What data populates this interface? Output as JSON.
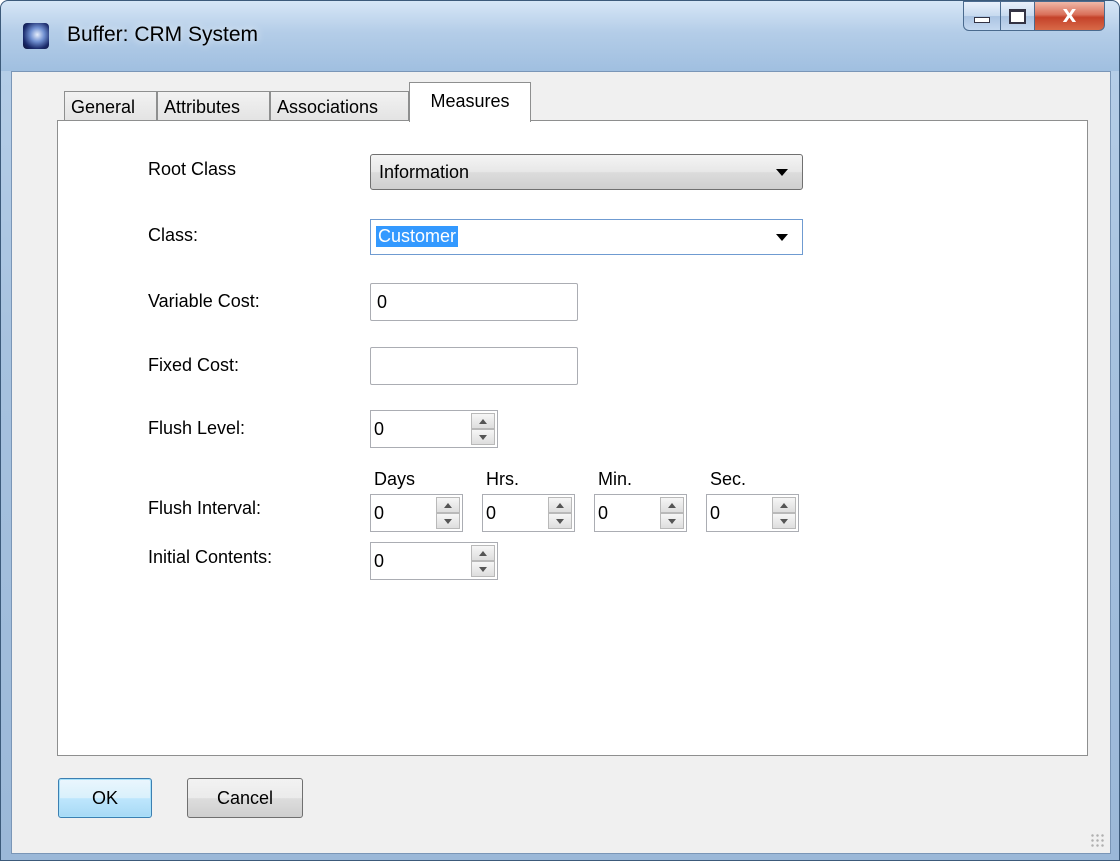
{
  "window": {
    "title": "Buffer: CRM System",
    "minimize_glyph": "",
    "maximize_glyph": "",
    "close_glyph": "X"
  },
  "tabs": [
    {
      "label": "General",
      "active": false
    },
    {
      "label": "Attributes",
      "active": false
    },
    {
      "label": "Associations",
      "active": false
    },
    {
      "label": "Measures",
      "active": true
    }
  ],
  "form": {
    "root_class": {
      "label": "Root Class",
      "value": "Information"
    },
    "class": {
      "label": "Class:",
      "value": "Customer"
    },
    "variable_cost": {
      "label": "Variable Cost:",
      "value": "0"
    },
    "fixed_cost": {
      "label": "Fixed Cost:",
      "value": ""
    },
    "flush_level": {
      "label": "Flush Level:",
      "value": "0"
    },
    "flush_interval": {
      "label": "Flush Interval:",
      "days": {
        "label": "Days",
        "value": "0"
      },
      "hrs": {
        "label": "Hrs.",
        "value": "0"
      },
      "min": {
        "label": "Min.",
        "value": "0"
      },
      "sec": {
        "label": "Sec.",
        "value": "0"
      }
    },
    "initial_contents": {
      "label": "Initial Contents:",
      "value": "0"
    }
  },
  "buttons": {
    "ok": "OK",
    "cancel": "Cancel"
  },
  "icons": {
    "app": "buffer-app-icon",
    "minimize": "minimize-icon",
    "maximize": "maximize-icon",
    "close": "close-icon",
    "dropdown": "chevron-down-icon",
    "spin_up": "spin-up-icon",
    "spin_down": "spin-down-icon"
  },
  "colors": {
    "selection": "#3399ff",
    "default_button_border": "#3c7fb1",
    "close_button": "#c4422a"
  }
}
